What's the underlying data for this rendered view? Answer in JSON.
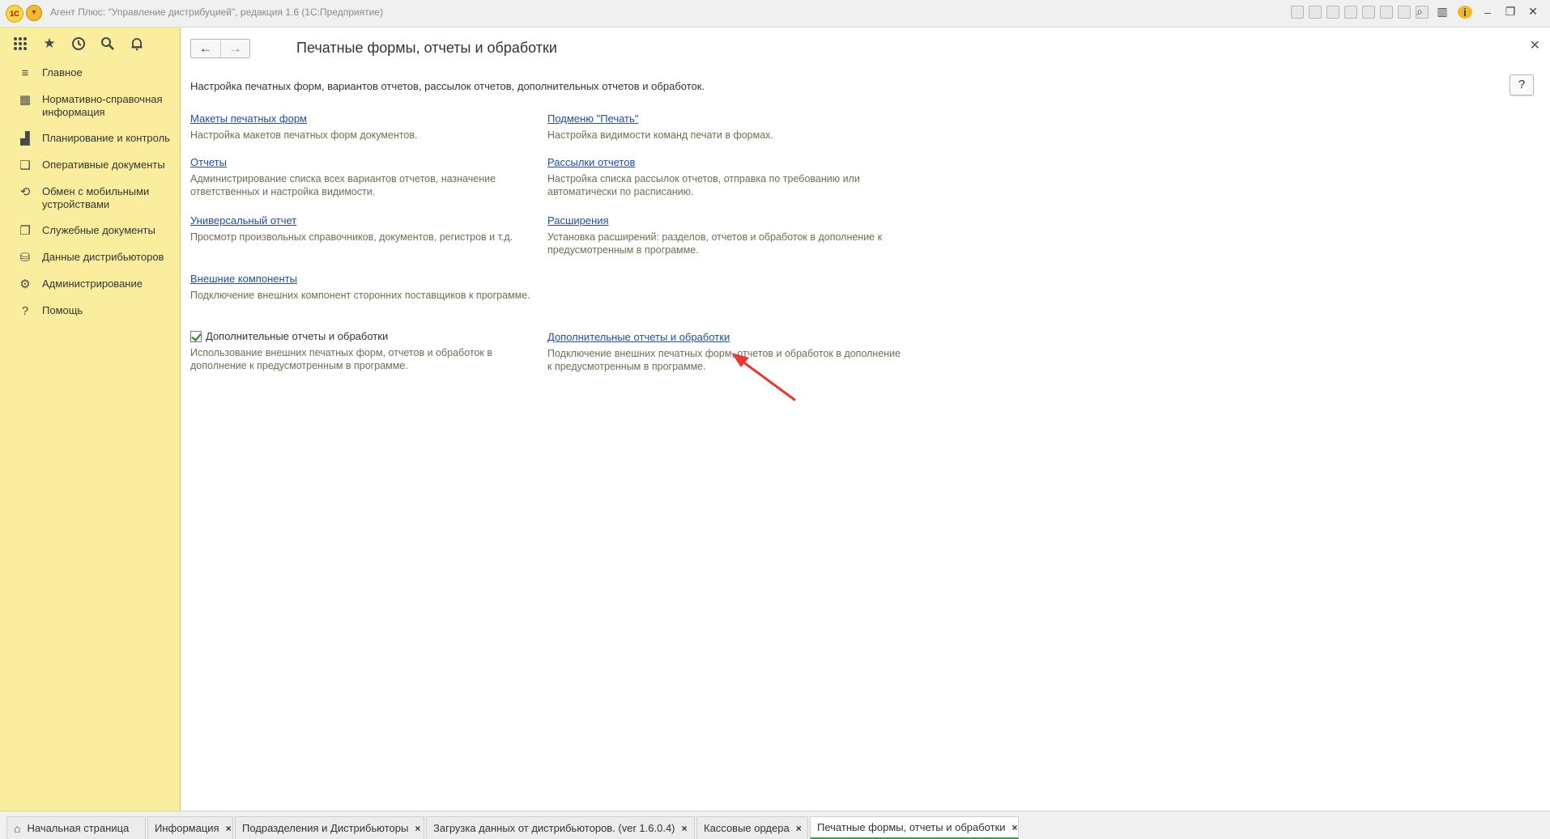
{
  "window": {
    "title": "Агент Плюс: \"Управление дистрибуцией\", редакция 1.6  (1С:Предприятие)",
    "logo_text": "1С"
  },
  "sidebar": {
    "items": [
      {
        "label": "Главное",
        "icon": "menu-lines-icon"
      },
      {
        "label": "Нормативно-справочная информация",
        "icon": "book-icon"
      },
      {
        "label": "Планирование и контроль",
        "icon": "chart-bars-icon"
      },
      {
        "label": "Оперативные документы",
        "icon": "documents-icon"
      },
      {
        "label": "Обмен с мобильными устройствами",
        "icon": "sync-icon"
      },
      {
        "label": "Служебные документы",
        "icon": "service-docs-icon"
      },
      {
        "label": "Данные дистрибьюторов",
        "icon": "distributor-icon"
      },
      {
        "label": "Администрирование",
        "icon": "gear-icon"
      },
      {
        "label": "Помощь",
        "icon": "question-icon"
      }
    ]
  },
  "page": {
    "title": "Печатные формы, отчеты и обработки",
    "intro": "Настройка печатных форм, вариантов отчетов, рассылок отчетов, дополнительных отчетов и обработок.",
    "help_label": "?"
  },
  "left_entries": [
    {
      "link": "Макеты печатных форм",
      "desc": "Настройка макетов печатных форм документов."
    },
    {
      "link": "Отчеты",
      "desc": "Администрирование списка всех вариантов отчетов, назначение ответственных и настройка видимости."
    },
    {
      "link": "Универсальный отчет",
      "desc": "Просмотр произвольных справочников, документов, регистров и т.д."
    },
    {
      "link": "Внешние компоненты",
      "desc": "Подключение внешних компонент сторонних поставщиков к программе."
    }
  ],
  "left_checkbox": {
    "label": "Дополнительные отчеты и обработки",
    "checked": true,
    "desc": "Использование внешних печатных форм, отчетов и обработок в дополнение к предусмотренным в программе."
  },
  "right_entries": [
    {
      "link": "Подменю \"Печать\"",
      "desc": "Настройка видимости команд печати в формах."
    },
    {
      "link": "Рассылки отчетов",
      "desc": "Настройка списка рассылок отчетов, отправка по требованию или автоматически по расписанию."
    },
    {
      "link": "Расширения",
      "desc": "Установка расширений: разделов, отчетов и обработок в дополнение к предусмотренным в программе."
    },
    {
      "link": "Дополнительные отчеты и обработки",
      "desc": "Подключение внешних печатных форм, отчетов и обработок в дополнение к предусмотренным в программе."
    }
  ],
  "tabs": [
    {
      "label": "Начальная страница",
      "closable": false
    },
    {
      "label": "Информация",
      "closable": true
    },
    {
      "label": "Подразделения и Дистрибьюторы",
      "closable": true
    },
    {
      "label": "Загрузка данных от дистрибьюторов. (ver 1.6.0.4)",
      "closable": true
    },
    {
      "label": "Кассовые ордера",
      "closable": true
    },
    {
      "label": "Печатные формы, отчеты и обработки",
      "closable": true,
      "active": true
    }
  ],
  "tab_close_glyph": "×",
  "colors": {
    "sidebar_bg": "#fbed9e",
    "link": "#1d4fa6",
    "arrow": "#e53935",
    "active_tab_line": "#2d9e4a"
  }
}
